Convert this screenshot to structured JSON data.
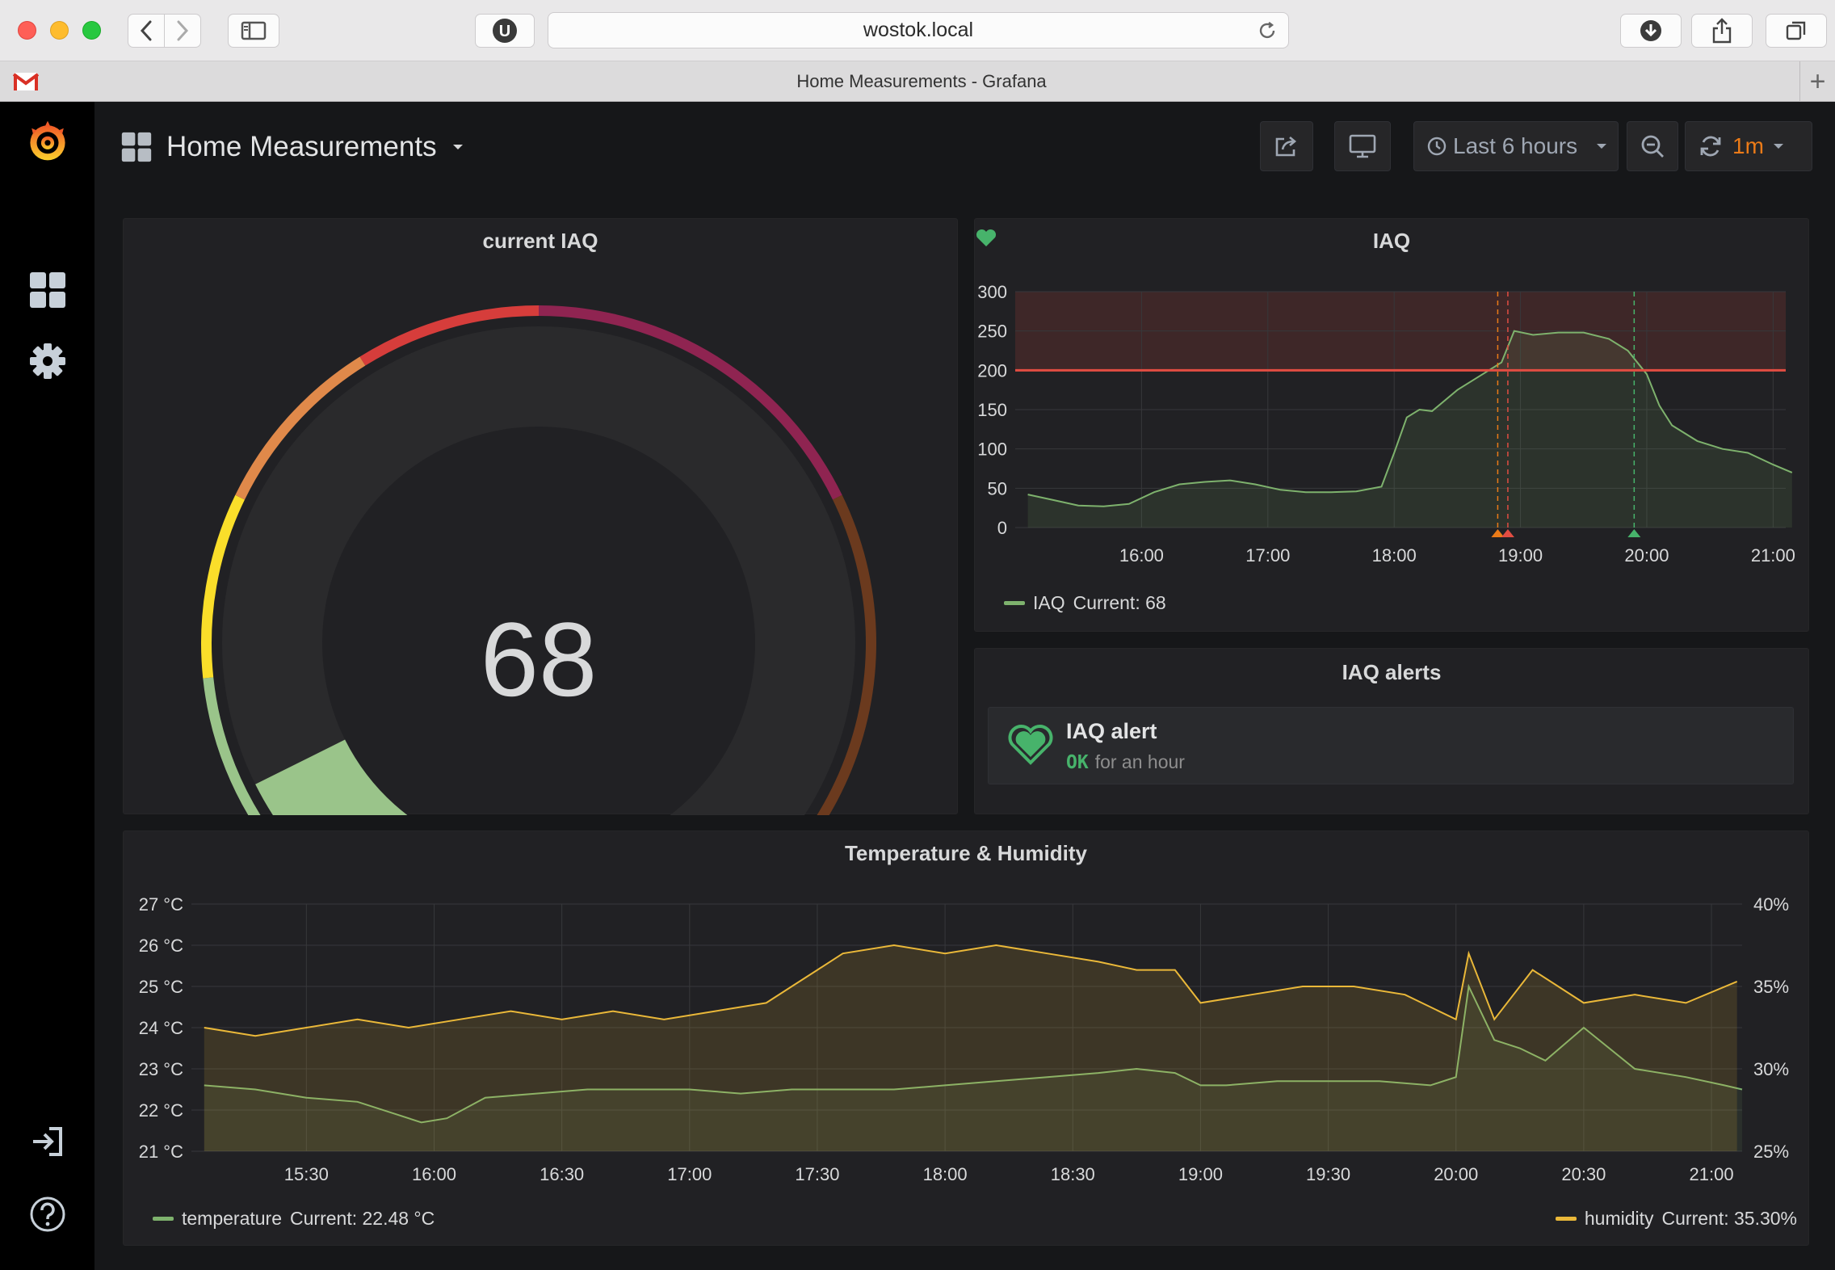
{
  "browser": {
    "url": "wostok.local",
    "tab_title": "Home Measurements - Grafana"
  },
  "dashboard": {
    "title": "Home Measurements",
    "time_range": "Last 6 hours",
    "refresh_interval": "1m"
  },
  "panels": {
    "gauge": {
      "title": "current IAQ",
      "value": "68"
    },
    "iaq_graph": {
      "title": "IAQ",
      "legend_name": "IAQ",
      "legend_current": "Current: 68"
    },
    "alerts": {
      "title": "IAQ alerts",
      "alert_name": "IAQ alert",
      "state": "OK",
      "duration": "for an hour"
    },
    "temp_graph": {
      "title": "Temperature & Humidity",
      "legend_left_name": "temperature",
      "legend_left_current": "Current: 22.48 °C",
      "legend_right_name": "humidity",
      "legend_right_current": "Current: 35.30%"
    }
  },
  "colors": {
    "iaq_series": "#7eb26d",
    "temperature_series": "#7eb26d",
    "humidity_series": "#eab839",
    "threshold": "#e24d42",
    "ok": "#47b36b",
    "accent": "#eb7b18"
  },
  "chart_data": [
    {
      "type": "gauge",
      "title": "current IAQ",
      "value": 68,
      "min": 0,
      "max": 500,
      "bands": [
        {
          "to": 50,
          "color": "#56d244"
        },
        {
          "to": 100,
          "color": "#9ac48a"
        },
        {
          "to": 150,
          "color": "#fade2a"
        },
        {
          "to": 200,
          "color": "#e0894a"
        },
        {
          "to": 250,
          "color": "#d63d3b"
        },
        {
          "to": 350,
          "color": "#8f2451"
        },
        {
          "to": 500,
          "color": "#6b3a1e"
        }
      ]
    },
    {
      "type": "line",
      "title": "IAQ",
      "x_ticks": [
        "16:00",
        "17:00",
        "18:00",
        "19:00",
        "20:00",
        "21:00"
      ],
      "y_ticks": [
        0,
        50,
        100,
        150,
        200,
        250,
        300
      ],
      "ylim": [
        0,
        300
      ],
      "threshold": 200,
      "grid": true,
      "series": [
        {
          "name": "IAQ",
          "x_hours": [
            15.1,
            15.3,
            15.5,
            15.7,
            15.9,
            16.1,
            16.3,
            16.5,
            16.7,
            16.9,
            17.1,
            17.3,
            17.5,
            17.7,
            17.9,
            18.0,
            18.1,
            18.2,
            18.3,
            18.5,
            18.7,
            18.85,
            18.95,
            19.1,
            19.3,
            19.5,
            19.7,
            19.85,
            20.0,
            20.05,
            20.1,
            20.2,
            20.4,
            20.6,
            20.8,
            21.0,
            21.15
          ],
          "values": [
            42,
            35,
            28,
            27,
            30,
            45,
            55,
            58,
            60,
            55,
            48,
            45,
            45,
            46,
            52,
            95,
            140,
            150,
            148,
            175,
            195,
            210,
            250,
            245,
            248,
            248,
            240,
            225,
            195,
            175,
            155,
            130,
            110,
            100,
            95,
            80,
            70
          ]
        }
      ],
      "legend": "bottom-left"
    },
    {
      "type": "line",
      "title": "Temperature & Humidity",
      "x_ticks": [
        "15:30",
        "16:00",
        "16:30",
        "17:00",
        "17:30",
        "18:00",
        "18:30",
        "19:00",
        "19:30",
        "20:00",
        "20:30",
        "21:00"
      ],
      "y_ticks_left": [
        "21 °C",
        "22 °C",
        "23 °C",
        "24 °C",
        "25 °C",
        "26 °C",
        "27 °C"
      ],
      "y_ticks_right": [
        "25%",
        "30%",
        "35%",
        "40%"
      ],
      "ylim_left": [
        21,
        27
      ],
      "ylim_right": [
        25,
        40
      ],
      "grid": true,
      "series": [
        {
          "name": "temperature",
          "axis": "left",
          "x_hours": [
            15.1,
            15.3,
            15.5,
            15.7,
            15.85,
            15.95,
            16.05,
            16.2,
            16.4,
            16.6,
            16.8,
            17.0,
            17.2,
            17.4,
            17.6,
            17.8,
            18.0,
            18.2,
            18.4,
            18.6,
            18.75,
            18.9,
            19.0,
            19.1,
            19.3,
            19.5,
            19.7,
            19.9,
            20.0,
            20.05,
            20.15,
            20.25,
            20.35,
            20.5,
            20.7,
            20.9,
            21.05,
            21.12
          ],
          "values": [
            22.6,
            22.5,
            22.3,
            22.2,
            21.9,
            21.7,
            21.8,
            22.3,
            22.4,
            22.5,
            22.5,
            22.5,
            22.4,
            22.5,
            22.5,
            22.5,
            22.6,
            22.7,
            22.8,
            22.9,
            23.0,
            22.9,
            22.6,
            22.6,
            22.7,
            22.7,
            22.7,
            22.6,
            22.8,
            25.0,
            23.7,
            23.5,
            23.2,
            24.0,
            23.0,
            22.8,
            22.6,
            22.5
          ]
        },
        {
          "name": "humidity",
          "axis": "right",
          "x_hours": [
            15.1,
            15.3,
            15.5,
            15.7,
            15.9,
            16.1,
            16.3,
            16.5,
            16.7,
            16.9,
            17.1,
            17.3,
            17.4,
            17.5,
            17.6,
            17.8,
            18.0,
            18.2,
            18.4,
            18.6,
            18.75,
            18.9,
            19.0,
            19.2,
            19.4,
            19.6,
            19.8,
            20.0,
            20.05,
            20.15,
            20.3,
            20.5,
            20.7,
            20.9,
            21.1
          ],
          "values": [
            32.5,
            32.0,
            32.5,
            33.0,
            32.5,
            33.0,
            33.5,
            33.0,
            33.5,
            33.0,
            33.5,
            34.0,
            35.0,
            36.0,
            37.0,
            37.5,
            37.0,
            37.5,
            37.0,
            36.5,
            36.0,
            36.0,
            34.0,
            34.5,
            35.0,
            35.0,
            34.5,
            33.0,
            37.0,
            33.0,
            36.0,
            34.0,
            34.5,
            34.0,
            35.3
          ]
        }
      ],
      "legend": "bottom"
    }
  ]
}
